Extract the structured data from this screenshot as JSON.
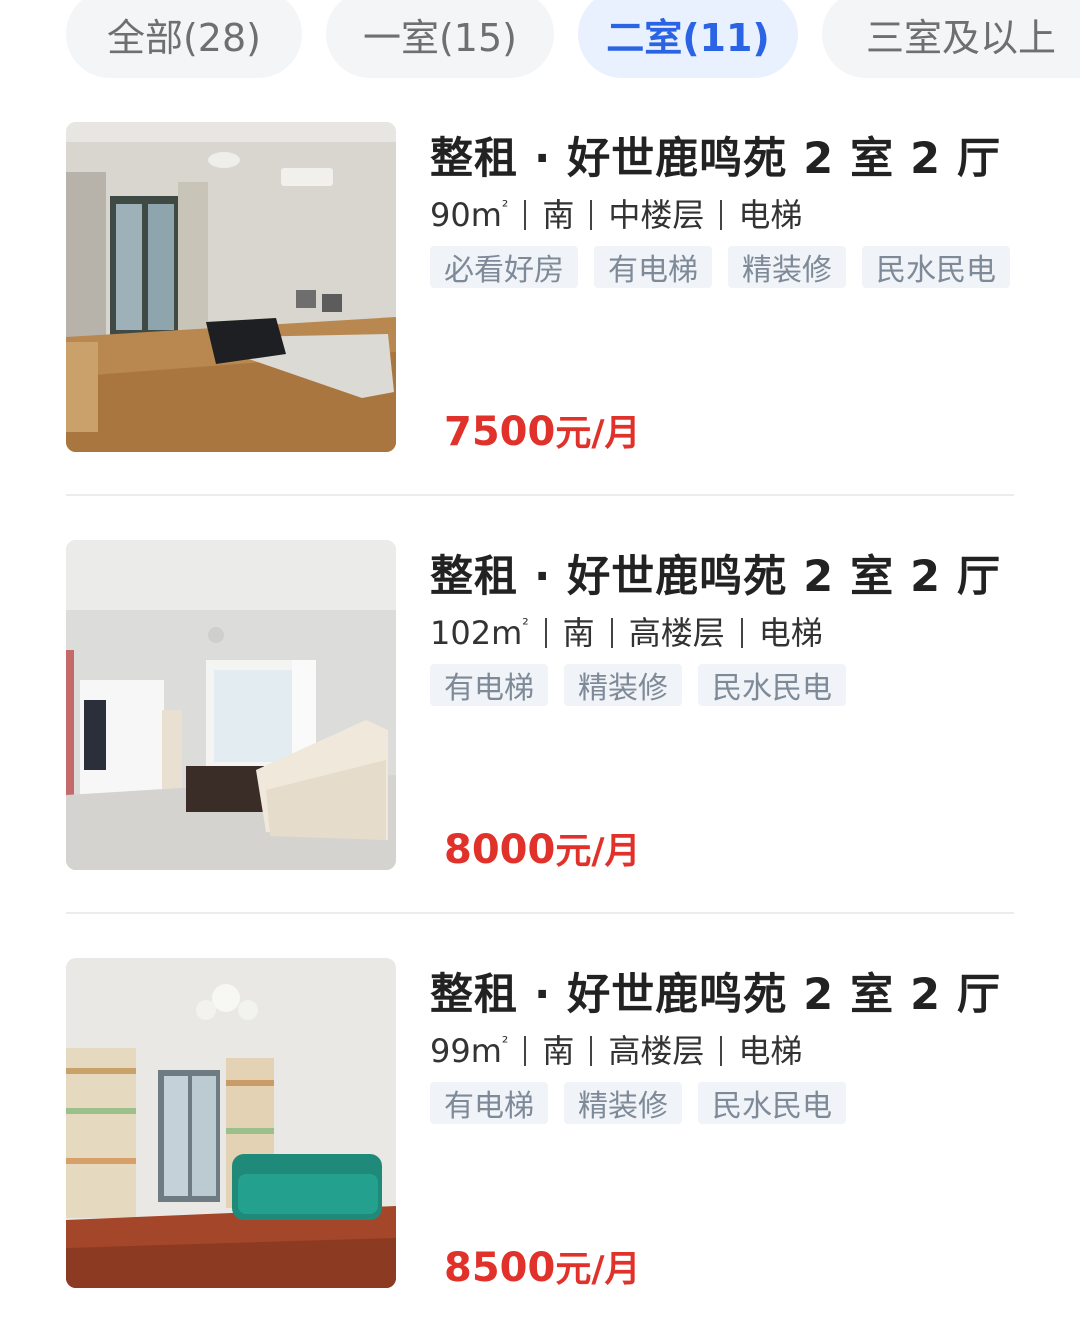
{
  "filters": [
    {
      "label": "全部(28)",
      "active": false
    },
    {
      "label": "一室(15)",
      "active": false
    },
    {
      "label": "二室(11)",
      "active": true
    },
    {
      "label": "三室及以上",
      "active": false
    }
  ],
  "listings": [
    {
      "title": "整租 · 好世鹿鸣苑 2 室 2 厅",
      "area": "90m",
      "area_unit": "²",
      "orientation": "南",
      "floor": "中楼层",
      "elevator": "电梯",
      "tags": [
        "必看好房",
        "有电梯",
        "精装修",
        "民水民电"
      ],
      "price": "7500",
      "price_unit": "元/月",
      "photo_icon": "living-room-photo"
    },
    {
      "title": "整租 · 好世鹿鸣苑 2 室 2 厅",
      "area": "102m",
      "area_unit": "²",
      "orientation": "南",
      "floor": "高楼层",
      "elevator": "电梯",
      "tags": [
        "有电梯",
        "精装修",
        "民水民电"
      ],
      "price": "8000",
      "price_unit": "元/月",
      "photo_icon": "living-room-photo"
    },
    {
      "title": "整租 · 好世鹿鸣苑 2 室 2 厅",
      "area": "99m",
      "area_unit": "²",
      "orientation": "南",
      "floor": "高楼层",
      "elevator": "电梯",
      "tags": [
        "有电梯",
        "精装修",
        "民水民电"
      ],
      "price": "8500",
      "price_unit": "元/月",
      "photo_icon": "living-room-photo"
    }
  ],
  "colors": {
    "accent_blue": "#2a63e4",
    "price_red": "#e0312a",
    "tag_text": "#7f8a99"
  }
}
